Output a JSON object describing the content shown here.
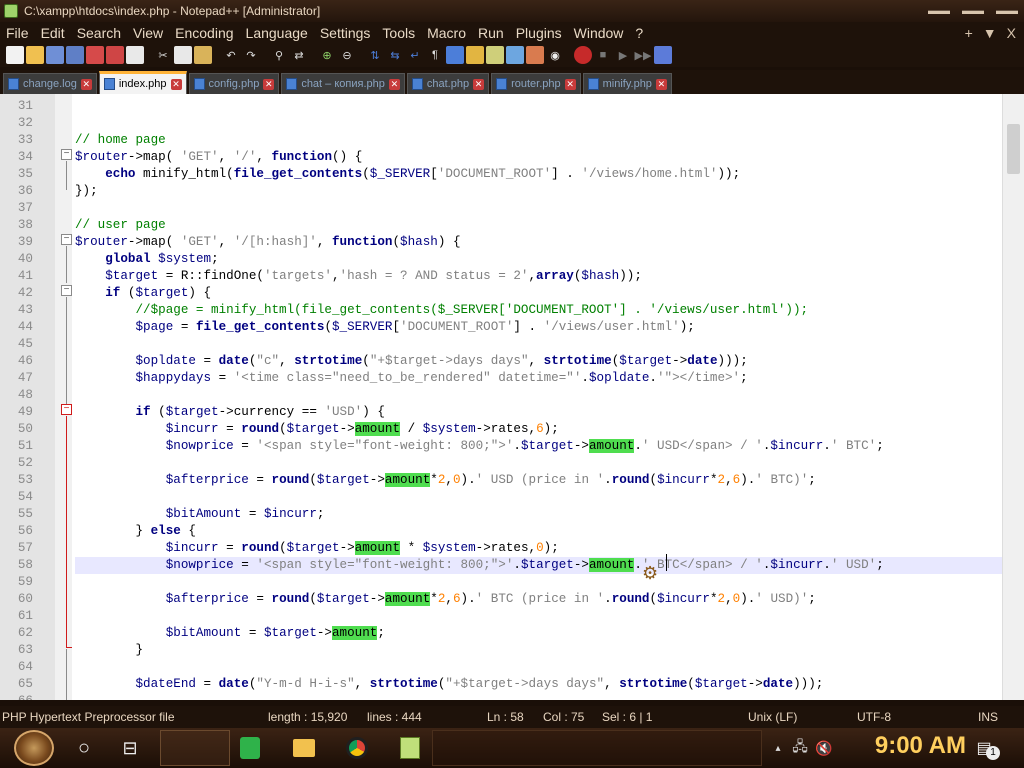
{
  "window": {
    "title": "C:\\xampp\\htdocs\\index.php - Notepad++ [Administrator]",
    "controls": [
      "minimize",
      "restore",
      "close"
    ]
  },
  "menu": {
    "items": [
      "File",
      "Edit",
      "Search",
      "View",
      "Encoding",
      "Language",
      "Settings",
      "Tools",
      "Macro",
      "Run",
      "Plugins",
      "Window",
      "?"
    ],
    "right": [
      "+",
      "▼",
      "X"
    ]
  },
  "tabs": [
    {
      "label": "change.log",
      "active": false
    },
    {
      "label": "index.php",
      "active": true
    },
    {
      "label": "config.php",
      "active": false
    },
    {
      "label": "chat – копия.php",
      "active": false
    },
    {
      "label": "chat.php",
      "active": false
    },
    {
      "label": "router.php",
      "active": false
    },
    {
      "label": "minify.php",
      "active": false
    }
  ],
  "editor": {
    "current_line": 58,
    "lines": [
      {
        "n": "31",
        "html": ""
      },
      {
        "n": "32",
        "html": ""
      },
      {
        "n": "33",
        "html": "<span class=\"c-com\">// home page</span>"
      },
      {
        "n": "34",
        "html": "<span class=\"c-var\">$router</span>-&gt;map( <span class=\"c-str\">'GET'</span>, <span class=\"c-str\">'/'</span>, <span class=\"c-kw\">function</span>() {"
      },
      {
        "n": "35",
        "html": "    <span class=\"c-kw\">echo</span> minify_html(<span class=\"c-fn\">file_get_contents</span>(<span class=\"c-var\">$_SERVER</span>[<span class=\"c-str\">'DOCUMENT_ROOT'</span>] . <span class=\"c-str\">'/views/home.html'</span>));"
      },
      {
        "n": "36",
        "html": "});"
      },
      {
        "n": "37",
        "html": ""
      },
      {
        "n": "38",
        "html": "<span class=\"c-com\">// user page</span>"
      },
      {
        "n": "39",
        "html": "<span class=\"c-var\">$router</span>-&gt;map( <span class=\"c-str\">'GET'</span>, <span class=\"c-str\">'/[h:hash]'</span>, <span class=\"c-kw\">function</span>(<span class=\"c-var\">$hash</span>) {"
      },
      {
        "n": "40",
        "html": "    <span class=\"c-kw\">global</span> <span class=\"c-var\">$system</span>;"
      },
      {
        "n": "41",
        "html": "    <span class=\"c-var\">$target</span> = R::findOne(<span class=\"c-str\">'targets'</span>,<span class=\"c-str\">'hash = ? AND status = 2'</span>,<span class=\"c-kw\">array</span>(<span class=\"c-var\">$hash</span>));"
      },
      {
        "n": "42",
        "html": "    <span class=\"c-kw\">if</span> (<span class=\"c-var\">$target</span>) {"
      },
      {
        "n": "43",
        "html": "        <span class=\"c-com\">//$page = minify_html(file_get_contents($_SERVER['DOCUMENT_ROOT'] . '/views/user.html'));</span>"
      },
      {
        "n": "44",
        "html": "        <span class=\"c-var\">$page</span> = <span class=\"c-fn\">file_get_contents</span>(<span class=\"c-var\">$_SERVER</span>[<span class=\"c-str\">'DOCUMENT_ROOT'</span>] . <span class=\"c-str\">'/views/user.html'</span>);"
      },
      {
        "n": "45",
        "html": ""
      },
      {
        "n": "46",
        "html": "        <span class=\"c-var\">$opldate</span> = <span class=\"c-fn\">date</span>(<span class=\"c-str\">\"c\"</span>, <span class=\"c-fn\">strtotime</span>(<span class=\"c-str\">\"+$target-&gt;days days\"</span>, <span class=\"c-fn\">strtotime</span>(<span class=\"c-var\">$target</span>-&gt;<span class=\"c-fn\">date</span>)));"
      },
      {
        "n": "47",
        "html": "        <span class=\"c-var\">$happydays</span> = <span class=\"c-str\">'&lt;time class=\"need_to_be_rendered\" datetime=\"'</span>.<span class=\"c-var\">$opldate</span>.<span class=\"c-str\">'\"&gt;&lt;/time&gt;'</span>;"
      },
      {
        "n": "48",
        "html": ""
      },
      {
        "n": "49",
        "html": "        <span class=\"c-kw\">if</span> (<span class=\"c-var\">$target</span>-&gt;currency == <span class=\"c-str\">'USD'</span>) {"
      },
      {
        "n": "50",
        "html": "            <span class=\"c-var\">$incurr</span> = <span class=\"c-fn\">round</span>(<span class=\"c-var\">$target</span>-&gt;<span class=\"hl\">amount</span> / <span class=\"c-var\">$system</span>-&gt;rates,<span class=\"c-num\">6</span>);"
      },
      {
        "n": "51",
        "html": "            <span class=\"c-var\">$nowprice</span> = <span class=\"c-str\">'&lt;span style=\"font-weight: 800;\"&gt;'</span>.<span class=\"c-var\">$target</span>-&gt;<span class=\"hl\">amount</span>.<span class=\"c-str\">' USD&lt;/span&gt; / '</span>.<span class=\"c-var\">$incurr</span>.<span class=\"c-str\">' BTC'</span>;"
      },
      {
        "n": "52",
        "html": ""
      },
      {
        "n": "53",
        "html": "            <span class=\"c-var\">$afterprice</span> = <span class=\"c-fn\">round</span>(<span class=\"c-var\">$target</span>-&gt;<span class=\"hl\">amount</span>*<span class=\"c-num\">2</span>,<span class=\"c-num\">0</span>).<span class=\"c-str\">' USD (price in '</span>.<span class=\"c-fn\">round</span>(<span class=\"c-var\">$incurr</span>*<span class=\"c-num\">2</span>,<span class=\"c-num\">6</span>).<span class=\"c-str\">' BTC)'</span>;"
      },
      {
        "n": "54",
        "html": ""
      },
      {
        "n": "55",
        "html": "            <span class=\"c-var\">$bitAmount</span> = <span class=\"c-var\">$incurr</span>;"
      },
      {
        "n": "56",
        "html": "        } <span class=\"c-kw\">else</span> {"
      },
      {
        "n": "57",
        "html": "            <span class=\"c-var\">$incurr</span> = <span class=\"c-fn\">round</span>(<span class=\"c-var\">$target</span>-&gt;<span class=\"hl\">amount</span> * <span class=\"c-var\">$system</span>-&gt;rates,<span class=\"c-num\">0</span>);"
      },
      {
        "n": "58",
        "html": "            <span class=\"c-var\">$nowprice</span> = <span class=\"c-str\">'&lt;span style=\"font-weight: 800;\"&gt;'</span>.<span class=\"c-var\">$target</span>-&gt;<span class=\"hl\">amount</span>.<span class=\"c-str\">' BTC&lt;/span&gt; / '</span>.<span class=\"c-var\">$incurr</span>.<span class=\"c-str\">' USD'</span>;"
      },
      {
        "n": "59",
        "html": ""
      },
      {
        "n": "60",
        "html": "            <span class=\"c-var\">$afterprice</span> = <span class=\"c-fn\">round</span>(<span class=\"c-var\">$target</span>-&gt;<span class=\"hl\">amount</span>*<span class=\"c-num\">2</span>,<span class=\"c-num\">6</span>).<span class=\"c-str\">' BTC (price in '</span>.<span class=\"c-fn\">round</span>(<span class=\"c-var\">$incurr</span>*<span class=\"c-num\">2</span>,<span class=\"c-num\">0</span>).<span class=\"c-str\">' USD)'</span>;"
      },
      {
        "n": "61",
        "html": ""
      },
      {
        "n": "62",
        "html": "            <span class=\"c-var\">$bitAmount</span> = <span class=\"c-var\">$target</span>-&gt;<span class=\"hl\">amount</span>;"
      },
      {
        "n": "63",
        "html": "        }"
      },
      {
        "n": "64",
        "html": ""
      },
      {
        "n": "65",
        "html": "        <span class=\"c-var\">$dateEnd</span> = <span class=\"c-fn\">date</span>(<span class=\"c-str\">\"Y-m-d H-i-s\"</span>, <span class=\"c-fn\">strtotime</span>(<span class=\"c-str\">\"+$target-&gt;days days\"</span>, <span class=\"c-fn\">strtotime</span>(<span class=\"c-var\">$target</span>-&gt;<span class=\"c-fn\">date</span>)));"
      },
      {
        "n": "66",
        "html": ""
      }
    ]
  },
  "status": {
    "filetype": "PHP Hypertext Preprocessor file",
    "length": "length : 15,920",
    "lines": "lines : 444",
    "ln": "Ln : 58",
    "col": "Col : 75",
    "sel": "Sel : 6 | 1",
    "eol": "Unix (LF)",
    "encoding": "UTF-8",
    "mode": "INS"
  },
  "taskbar": {
    "clock": "9:00 AM",
    "notification_count": "1"
  },
  "colors": {
    "accent_tab": "#ffb338",
    "highlight": "#4fdd4f",
    "current_line": "#e8e8ff"
  }
}
